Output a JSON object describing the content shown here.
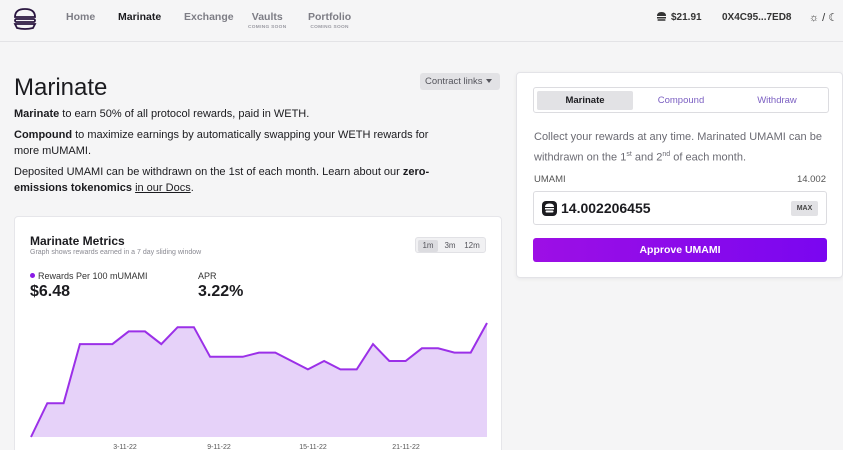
{
  "nav": {
    "items": [
      {
        "label": "Home",
        "sub": ""
      },
      {
        "label": "Marinate",
        "sub": ""
      },
      {
        "label": "Exchange",
        "sub": ""
      },
      {
        "label": "Vaults",
        "sub": "COMING SOON"
      },
      {
        "label": "Portfolio",
        "sub": "COMING SOON"
      }
    ],
    "price": "$21.91",
    "wallet": "0X4C95...7ED8",
    "theme_toggle": "☼ / ☾"
  },
  "page": {
    "title": "Marinate",
    "links_button": "Contract links",
    "p1_bold": "Marinate",
    "p1_rest": " to earn 50% of all protocol rewards, paid in WETH.",
    "p2_bold": "Compound",
    "p2_rest": " to maximize earnings by automatically swapping your WETH rewards for more mUMAMI.",
    "p3_start": "Deposited UMAMI can be withdrawn on the 1st of each month. Learn about our ",
    "p3_bold": "zero-emissions tokenomics",
    "p3_space": " ",
    "p3_link": "in our Docs",
    "p3_end": "."
  },
  "metrics": {
    "title": "Marinate Metrics",
    "subtitle": "Graph shows rewards earned in a 7 day sliding window",
    "ranges": [
      "1m",
      "3m",
      "12m"
    ],
    "active_range": "1m",
    "rewards_label": "Rewards Per 100 mUMAMI",
    "rewards_value": "$6.48",
    "apr_label": "APR",
    "apr_value": "3.22%"
  },
  "chart_data": {
    "type": "area",
    "x_ticks": [
      "3-11-22",
      "9-11-22",
      "15-11-22",
      "21-11-22"
    ],
    "values": [
      2.8,
      3.6,
      3.6,
      5.0,
      5.0,
      5.0,
      5.3,
      5.3,
      5.0,
      5.4,
      5.4,
      4.7,
      4.7,
      4.7,
      4.8,
      4.8,
      4.6,
      4.4,
      4.6,
      4.4,
      4.4,
      5.0,
      4.6,
      4.6,
      4.9,
      4.9,
      4.8,
      4.8,
      5.5
    ],
    "series_color": "#9b30e8",
    "fill_color": "#e6d2f9"
  },
  "panel": {
    "tabs": [
      "Marinate",
      "Compound",
      "Withdraw"
    ],
    "active_tab": "Marinate",
    "desc_1": "Collect your rewards at any time. Marinated UMAMI can be withdrawn on the 1",
    "sup_1": "st",
    "desc_2": " and 2",
    "sup_2": "nd",
    "desc_3": " of each month.",
    "balance_label": "UMAMI",
    "balance_value": "14.002",
    "amount": "14.002206455",
    "max_label": "MAX",
    "approve_label": "Approve UMAMI"
  }
}
